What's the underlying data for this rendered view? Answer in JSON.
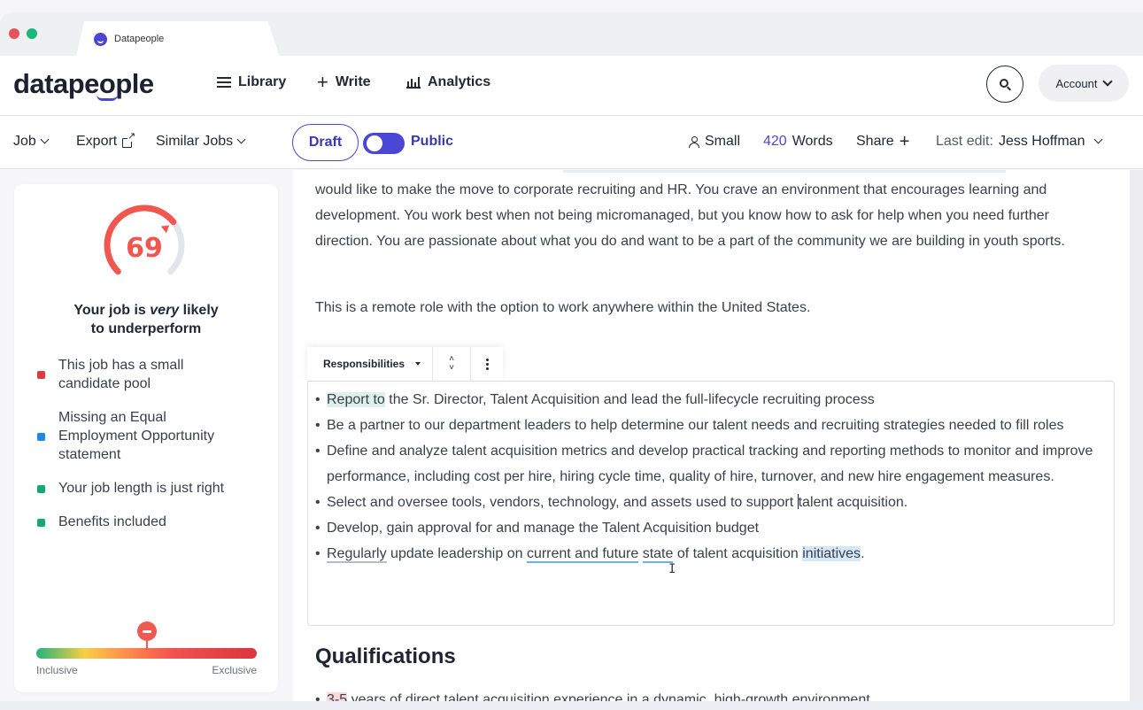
{
  "browser": {
    "tab_title": "Datapeople"
  },
  "header": {
    "logo": "datapeople",
    "nav": [
      {
        "label": "Library",
        "icon": "menu-icon"
      },
      {
        "label": "Write",
        "icon": "plus-icon"
      },
      {
        "label": "Analytics",
        "icon": "bar-chart-icon"
      }
    ],
    "account_label": "Account"
  },
  "toolbar": {
    "job_label": "Job",
    "export_label": "Export",
    "similar_jobs_label": "Similar Jobs",
    "draft_label": "Draft",
    "public_label": "Public",
    "public_toggle_on": true,
    "pool_size": "Small",
    "word_count": "420",
    "words_label": "Words",
    "share_label": "Share",
    "last_edit_label": "Last edit:",
    "last_edit_user": "Jess Hoffman"
  },
  "score_card": {
    "score": "69",
    "score_fraction": 0.69,
    "verdict_prefix": "Your job is ",
    "verdict_emphasis": "very",
    "verdict_suffix": " likely",
    "verdict_line2": "to underperform",
    "factors": [
      {
        "text": "This job has a small candidate pool",
        "color": "#e0393e"
      },
      {
        "text": "Missing an Equal Employment Opportunity statement",
        "color": "#1e88e5"
      },
      {
        "text": "Your job length is just right",
        "color": "#16a874"
      },
      {
        "text": "Benefits included",
        "color": "#16a874"
      }
    ],
    "scale_left": "Inclusive",
    "scale_right": "Exclusive",
    "scale_position": 0.5
  },
  "document": {
    "intro_paragraph": "would like to make the move to corporate recruiting and HR. You crave an environment that encourages learning and development. You work best when not being micromanaged, but you know how to ask for help when you need further direction. You are passionate about what you do and want to be a part of the community we are building in youth sports.",
    "remote_paragraph": "This is a remote role with the option to work anywhere within the United States.",
    "section_select": "Responsibilities",
    "responsibilities": {
      "b1_hl": "Report to",
      "b1_rest": " the Sr. Director, Talent Acquisition and lead the full-lifecycle recruiting process",
      "b2": "Be a partner to our department leaders to help determine our talent needs and recruiting strategies needed to fill roles",
      "b3": "Define and analyze talent acquisition metrics and develop practical tracking and reporting methods to monitor and improve performance, including cost per hire, hiring cycle time, quality of hire, turnover, and new hire engagement measures.",
      "b4_before": "Select and oversee tools, vendors, technology, and assets used to support ",
      "b4_after": "talent acquisition.",
      "b5": "Develop, gain approval for and manage the Talent Acquisition budget",
      "b6_ul": "Regularly",
      "b6_a": " update leadership on ",
      "b6_ul2": "current and future",
      "b6_b": " ",
      "b6_ul3": "state",
      "b6_c": " of talent acquisition ",
      "b6_hl": "initiatives",
      "b6_end": "."
    },
    "qualifications_heading": "Qualifications",
    "qualifications": {
      "q1_hl": "3-5",
      "q1_rest": " years of direct talent acquisition experience in a dynamic, high-growth environment"
    }
  },
  "colors": {
    "brand": "#4a47d4",
    "score": "#f2574f"
  }
}
